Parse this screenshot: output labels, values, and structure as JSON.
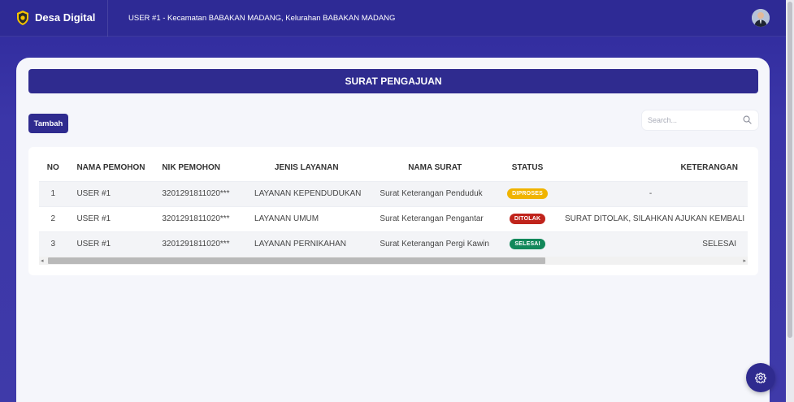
{
  "app": {
    "title": "Desa Digital"
  },
  "header": {
    "user_info": "USER #1 - Kecamatan BABAKAN MADANG, Kelurahan BABAKAN MADANG"
  },
  "page": {
    "title": "SURAT PENGAJUAN"
  },
  "toolbar": {
    "add_label": "Tambah",
    "search_placeholder": "Search..."
  },
  "table": {
    "columns": {
      "no": "NO",
      "nama": "NAMA PEMOHON",
      "nik": "NIK PEMOHON",
      "jenis": "JENIS LAYANAN",
      "surat": "NAMA SURAT",
      "status": "STATUS",
      "ket": "KETERANGAN"
    },
    "rows": [
      {
        "no": "1",
        "nama": "USER #1",
        "nik": "3201291811020***",
        "jenis": "LAYANAN KEPENDUDUKAN",
        "surat": "Surat Keterangan Penduduk",
        "status": "DIPROSES",
        "ket": "-"
      },
      {
        "no": "2",
        "nama": "USER #1",
        "nik": "3201291811020***",
        "jenis": "LAYANAN UMUM",
        "surat": "Surat Keterangan Pengantar",
        "status": "DITOLAK",
        "ket": "SURAT DITOLAK, SILAHKAN AJUKAN KEMBALI"
      },
      {
        "no": "3",
        "nama": "USER #1",
        "nik": "3201291811020***",
        "jenis": "LAYANAN PERNIKAHAN",
        "surat": "Surat Keterangan Pergi Kawin",
        "status": "SELESAI",
        "ket": "SELESAI"
      }
    ]
  },
  "colors": {
    "primary": "#2f2b8f",
    "status_diproses": "#f0b400",
    "status_ditolak": "#c0241c",
    "status_selesai": "#12885a"
  },
  "icons": {
    "brand": "shield-logo-icon",
    "search": "search-icon",
    "fab": "gear-icon"
  }
}
